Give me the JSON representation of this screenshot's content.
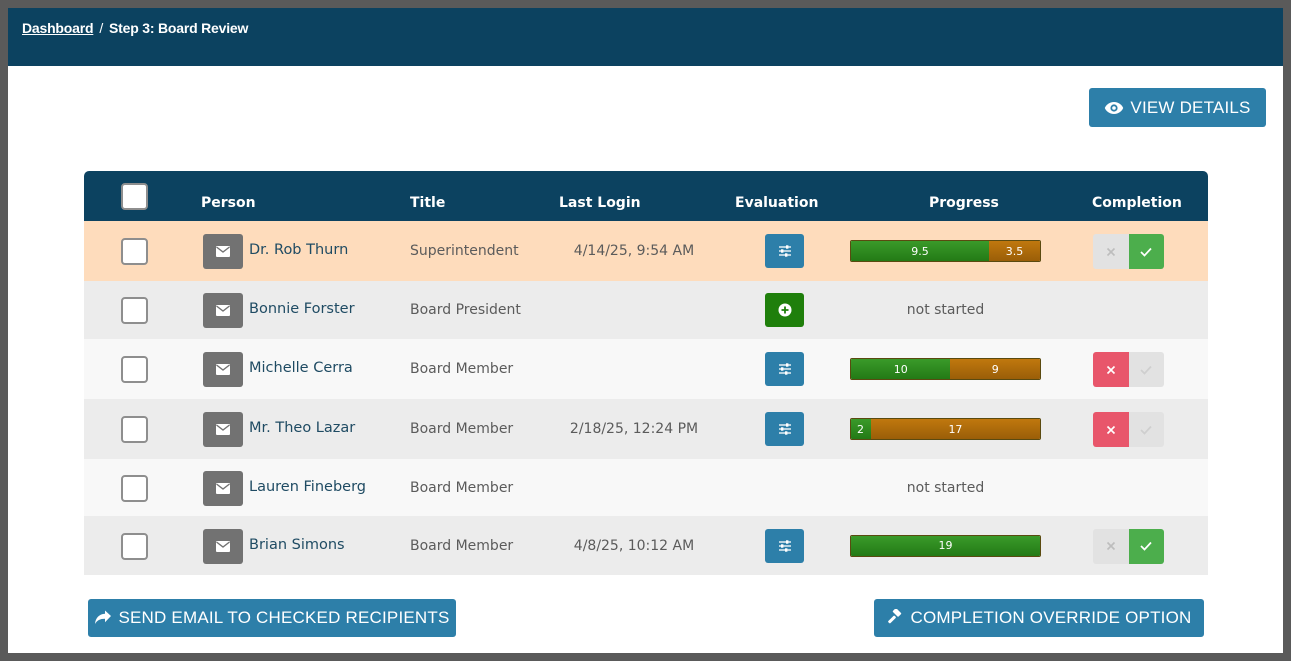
{
  "breadcrumb": {
    "home": "Dashboard",
    "separator": "/",
    "current": "Step 3: Board Review"
  },
  "buttons": {
    "view_details": "VIEW DETAILS",
    "send_email": "SEND EMAIL TO CHECKED RECIPIENTS",
    "completion_override": "COMPLETION OVERRIDE OPTION"
  },
  "table": {
    "headers": {
      "person": "Person",
      "title": "Title",
      "last_login": "Last Login",
      "evaluation": "Evaluation",
      "progress": "Progress",
      "completion": "Completion"
    },
    "rows": [
      {
        "name": "Dr. Rob Thurn",
        "title": "Superintendent",
        "last_login": "4/14/25, 9:54 AM",
        "evaluation": "settings",
        "progress_complete": 9.5,
        "progress_remaining": 3.5,
        "progress_complete_label": "9.5",
        "progress_remaining_label": "3.5",
        "completion": "complete",
        "highlight": true
      },
      {
        "name": "Bonnie Forster",
        "title": "Board President",
        "last_login": "",
        "evaluation": "add",
        "progress_text": "not started",
        "completion": "none"
      },
      {
        "name": "Michelle Cerra",
        "title": "Board Member",
        "last_login": "",
        "evaluation": "settings",
        "progress_complete": 10,
        "progress_remaining": 9,
        "progress_complete_label": "10",
        "progress_remaining_label": "9",
        "completion": "incomplete"
      },
      {
        "name": "Mr. Theo Lazar",
        "title": "Board Member",
        "last_login": "2/18/25, 12:24 PM",
        "evaluation": "settings",
        "progress_complete": 2,
        "progress_remaining": 17,
        "progress_complete_label": "2",
        "progress_remaining_label": "17",
        "completion": "incomplete"
      },
      {
        "name": "Lauren Fineberg",
        "title": "Board Member",
        "last_login": "",
        "evaluation": "none",
        "progress_text": "not started",
        "completion": "none"
      },
      {
        "name": "Brian Simons",
        "title": "Board Member",
        "last_login": "4/8/25, 10:12 AM",
        "evaluation": "settings",
        "progress_complete": 19,
        "progress_remaining": 0,
        "progress_complete_label": "19",
        "progress_remaining_label": "",
        "completion": "complete"
      }
    ]
  },
  "colors": {
    "header_bg": "#0c4260",
    "accent": "#2d7fa9",
    "highlight_row": "#fedcbc",
    "progress_complete": "#2e8b22",
    "progress_remaining": "#b06c0b",
    "reject": "#e8566b",
    "approve": "#4cae4c"
  },
  "icons": {
    "view": "eye-icon",
    "send": "share-arrow-icon",
    "override": "gavel-icon",
    "mail": "envelope-icon",
    "evaluation_settings": "sliders-icon",
    "evaluation_add": "plus-circle-icon",
    "reject": "x-icon",
    "approve": "check-icon"
  }
}
